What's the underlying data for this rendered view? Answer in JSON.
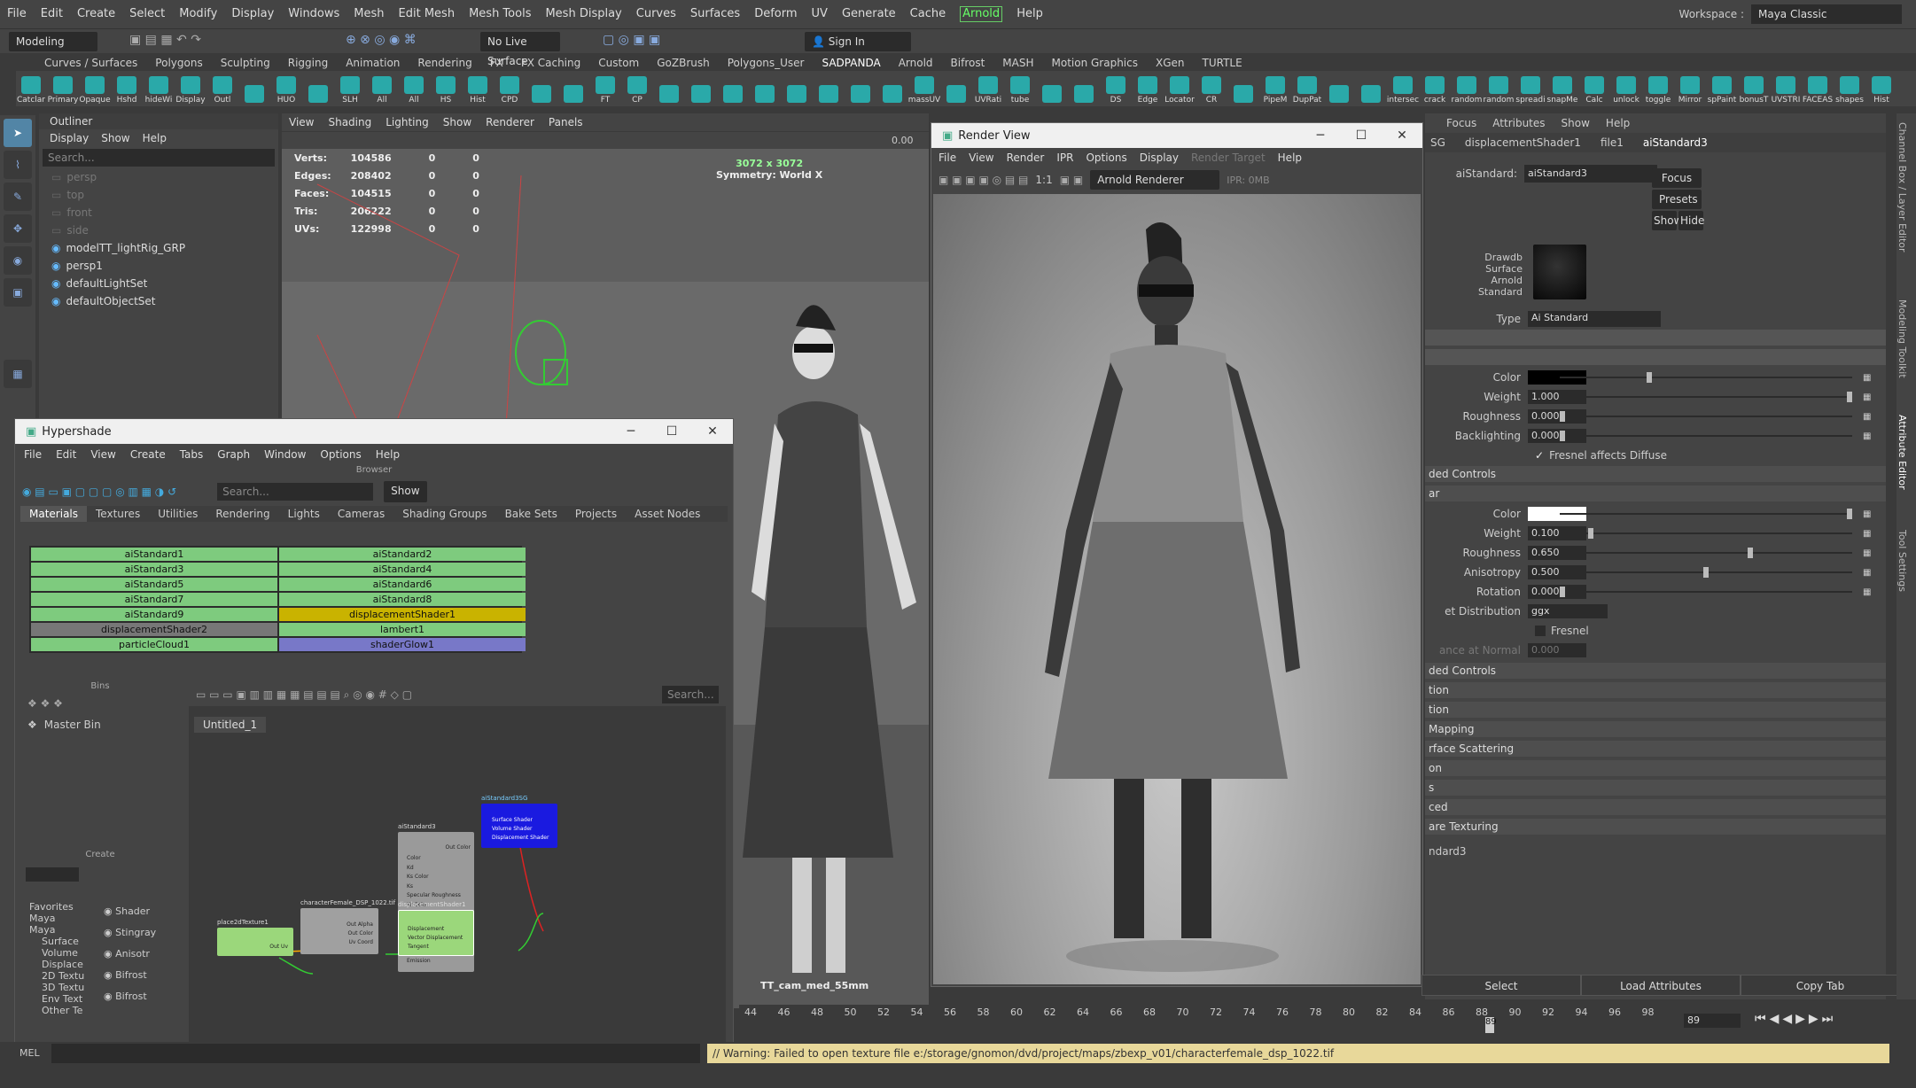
{
  "menubar": {
    "items": [
      "File",
      "Edit",
      "Create",
      "Select",
      "Modify",
      "Display",
      "Windows",
      "Mesh",
      "Edit Mesh",
      "Mesh Tools",
      "Mesh Display",
      "Curves",
      "Surfaces",
      "Deform",
      "UV",
      "Generate",
      "Cache",
      "Arnold",
      "Help"
    ],
    "workspace_label": "Workspace :",
    "workspace_value": "Maya Classic"
  },
  "statusline": {
    "mode": "Modeling",
    "live_surface": "No Live Surface",
    "sign_in": "Sign In"
  },
  "shelf": {
    "tabs": [
      "Curves / Surfaces",
      "Polygons",
      "Sculpting",
      "Rigging",
      "Animation",
      "Rendering",
      "FX",
      "FX Caching",
      "Custom",
      "GoZBrush",
      "Polygons_User",
      "SADPANDA",
      "Arnold",
      "Bifrost",
      "MASH",
      "Motion Graphics",
      "XGen",
      "TURTLE"
    ],
    "active_tab": "SADPANDA",
    "items": [
      "Catclar",
      "Primary",
      "Opaque",
      "Hshd",
      "hideWi",
      "Display",
      "Outl",
      "",
      "HUO",
      "",
      "SLH",
      "All",
      "All",
      "HS",
      "Hist",
      "CPD",
      "",
      "",
      "FT",
      "CP",
      "",
      "",
      "",
      "",
      "",
      "",
      "",
      "",
      "massUV",
      "",
      "UVRati",
      "tube",
      "",
      "",
      "DS",
      "Edge",
      "Locator",
      "CR",
      "",
      "PipeM",
      "DupPat",
      "",
      "",
      "intersec",
      "crack",
      "random",
      "random",
      "spreadi",
      "snapMe",
      "Calc",
      "unlock",
      "toggle",
      "Mirror",
      "spPaint",
      "bonusT",
      "UVSTRI",
      "FACEAS",
      "shapes",
      "Hist"
    ]
  },
  "outliner": {
    "title": "Outliner",
    "menu": [
      "Display",
      "Show",
      "Help"
    ],
    "search_placeholder": "Search...",
    "items": [
      {
        "label": "persp",
        "dim": true
      },
      {
        "label": "top",
        "dim": true
      },
      {
        "label": "front",
        "dim": true
      },
      {
        "label": "side",
        "dim": true
      },
      {
        "label": "modelTT_lightRig_GRP",
        "dim": false
      },
      {
        "label": "persp1",
        "dim": false
      },
      {
        "label": "defaultLightSet",
        "dim": false
      },
      {
        "label": "defaultObjectSet",
        "dim": false
      }
    ]
  },
  "viewport": {
    "menu": [
      "View",
      "Shading",
      "Lighting",
      "Show",
      "Renderer",
      "Panels"
    ],
    "zoom_value": "0.00",
    "hud": {
      "rows": [
        {
          "label": "Verts:",
          "v1": "104586",
          "v2": "0",
          "v3": "0"
        },
        {
          "label": "Edges:",
          "v1": "208402",
          "v2": "0",
          "v3": "0"
        },
        {
          "label": "Faces:",
          "v1": "104515",
          "v2": "0",
          "v3": "0"
        },
        {
          "label": "Tris:",
          "v1": "206222",
          "v2": "0",
          "v3": "0"
        },
        {
          "label": "UVs:",
          "v1": "122998",
          "v2": "0",
          "v3": "0"
        }
      ]
    },
    "resolution": "3072 x 3072",
    "symmetry": "Symmetry: World X",
    "camera": "TT_cam_med_55mm"
  },
  "hypershade": {
    "title": "Hypershade",
    "menu": [
      "File",
      "Edit",
      "View",
      "Create",
      "Tabs",
      "Graph",
      "Window",
      "Options",
      "Help"
    ],
    "browser_label": "Browser",
    "search_placeholder": "Search...",
    "show_button": "Show",
    "tabs": [
      "Materials",
      "Textures",
      "Utilities",
      "Rendering",
      "Lights",
      "Cameras",
      "Shading Groups",
      "Bake Sets",
      "Projects",
      "Asset Nodes"
    ],
    "materials": [
      {
        "name": "aiStandard1",
        "color": "green"
      },
      {
        "name": "aiStandard2",
        "color": "green"
      },
      {
        "name": "aiStandard3",
        "color": "green"
      },
      {
        "name": "aiStandard4",
        "color": "green"
      },
      {
        "name": "aiStandard5",
        "color": "green"
      },
      {
        "name": "aiStandard6",
        "color": "green"
      },
      {
        "name": "aiStandard7",
        "color": "green"
      },
      {
        "name": "aiStandard8",
        "color": "green"
      },
      {
        "name": "aiStandard9",
        "color": "green"
      },
      {
        "name": "displacementShader1",
        "color": "yellow"
      },
      {
        "name": "displacementShader2",
        "color": "gray"
      },
      {
        "name": "lambert1",
        "color": "green"
      },
      {
        "name": "particleCloud1",
        "color": "green"
      },
      {
        "name": "shaderGlow1",
        "color": "purple"
      }
    ],
    "bins_label": "Bins",
    "master_bin": "Master Bin",
    "create_label": "Create",
    "create_tree": [
      "Favorites",
      "Maya",
      "Maya",
      "Surface",
      "Volume",
      "Displace",
      "2D Textu",
      "3D Textu",
      "Env Text",
      "Other Te"
    ],
    "create_list": [
      "Shader",
      "Stingray",
      "Anisotr",
      "Bifrost",
      "Bifrost"
    ],
    "graph_search": "Search...",
    "graph_tab": "Untitled_1",
    "nodes": {
      "ai": {
        "title": "aiStandard3",
        "out": "Out Color",
        "attrs": [
          "Color",
          "Kd",
          "Ks Color",
          "Ks",
          "Specular Roughness",
          "Kr Color",
          "Kr",
          "Normal Camera",
          "Kssd Color",
          "Kssd",
          "Emission Color",
          "Emission"
        ]
      },
      "sg": {
        "title": "aiStandard3SG",
        "attrs": [
          "Surface Shader",
          "Volume Shader",
          "Displacement Shader"
        ]
      },
      "p2d": {
        "title": "place2dTexture1",
        "attrs": [
          "Out Uv"
        ]
      },
      "file": {
        "title": "characterFemale_DSP_1022.tif",
        "attrs": [
          "Out Alpha",
          "Out Color",
          "Uv Coord"
        ]
      },
      "disp": {
        "title": "displacementShader1",
        "attrs": [
          "Displacement",
          "Vector Displacement",
          "Tangent"
        ]
      }
    }
  },
  "render_view": {
    "title": "Render View",
    "menu": [
      "File",
      "View",
      "Render",
      "IPR",
      "Options",
      "Display",
      "Render Target",
      "Help"
    ],
    "ratio": "1:1",
    "renderer": "Arnold Renderer",
    "ipr": "IPR: 0MB"
  },
  "attribute_editor": {
    "menu": [
      "Focus",
      "Attributes",
      "Show",
      "Help"
    ],
    "tabs": [
      "SG",
      "displacementShader1",
      "file1",
      "aiStandard3"
    ],
    "node_label": "aiStandard:",
    "node_value": "aiStandard3",
    "focus": "Focus",
    "presets": "Presets",
    "show": "Show",
    "hide": "Hide",
    "swatch_caption": [
      "Drawdb",
      "Surface",
      "Arnold",
      "Standard"
    ],
    "type_label": "Type",
    "type_value": "Ai Standard",
    "diffuse": {
      "color_label": "Color",
      "weight_label": "Weight",
      "weight": "1.000",
      "roughness_label": "Roughness",
      "roughness": "0.000",
      "backlighting_label": "Backlighting",
      "backlighting": "0.000",
      "fresnel_diffuse": "Fresnel affects Diffuse"
    },
    "advanced1": "ded Controls",
    "specular_header": "ar",
    "specular": {
      "color_label": "Color",
      "weight_label": "Weight",
      "weight": "0.100",
      "roughness_label": "Roughness",
      "roughness": "0.650",
      "anisotropy_label": "Anisotropy",
      "anisotropy": "0.500",
      "rotation_label": "Rotation",
      "rotation": "0.000",
      "distribution_label": "et Distribution",
      "distribution": "ggx",
      "fresnel": "Fresnel",
      "normal_label": "ance at Normal",
      "normal": "0.000"
    },
    "sections": [
      "ded Controls",
      "tion",
      "tion",
      "Mapping",
      "rface Scattering",
      "on",
      "s",
      "ced",
      "are Texturing"
    ],
    "footer": "ndard3",
    "buttons": [
      "Select",
      "Load Attributes",
      "Copy Tab"
    ]
  },
  "timeline": {
    "ticks": [
      "44",
      "46",
      "48",
      "50",
      "52",
      "54",
      "56",
      "58",
      "60",
      "62",
      "64",
      "66",
      "68",
      "70",
      "72",
      "74",
      "76",
      "78",
      "80",
      "82",
      "84",
      "86",
      "88",
      "90",
      "92",
      "94",
      "96",
      "98"
    ],
    "current": "89",
    "frame_field": "89"
  },
  "command": {
    "label": "MEL",
    "warning": "// Warning: Failed to open texture file e:/storage/gnomon/dvd/project/maps/zbexp_v01/characterfemale_dsp_1022.tif"
  },
  "side_tabs": [
    "Channel Box / Layer Editor",
    "Modeling Toolkit",
    "Attribute Editor",
    "Tool Settings"
  ]
}
